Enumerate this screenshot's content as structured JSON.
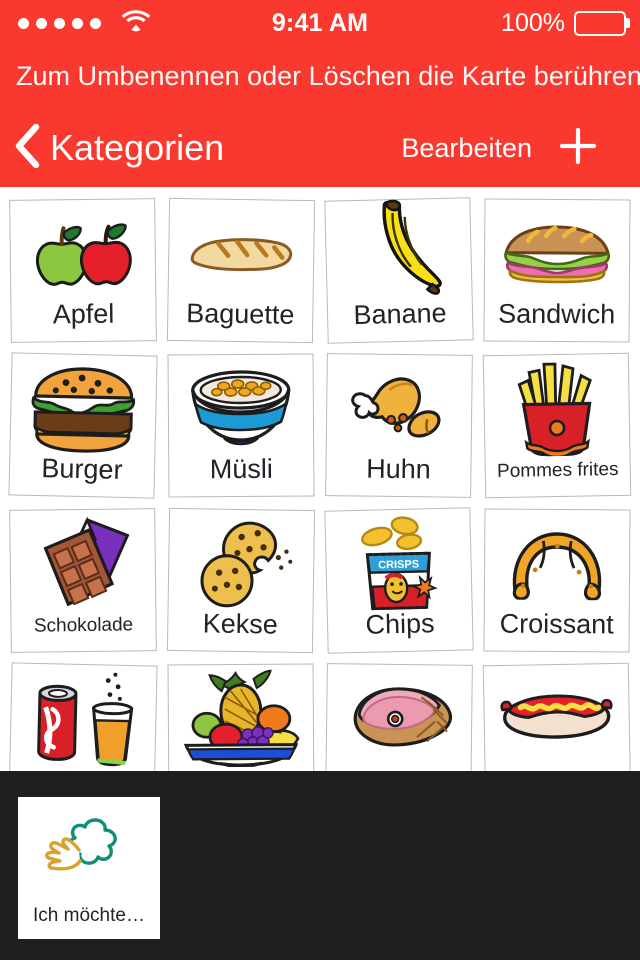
{
  "status_bar": {
    "signal_dots": 5,
    "wifi_icon": "wifi-icon",
    "time": "9:41 AM",
    "battery_percent": "100%",
    "battery_icon": "battery-full-icon"
  },
  "banner": {
    "text": "Zum Umbenennen oder Löschen die Karte berühren"
  },
  "navbar": {
    "back_icon": "chevron-left-icon",
    "back_label": "Kategorien",
    "edit_label": "Bearbeiten",
    "add_icon": "plus-icon"
  },
  "colors": {
    "header_red": "#f9392f",
    "bottom_bar": "#1f1f1f",
    "card_border": "#b9b9bd",
    "label_text": "#222228"
  },
  "grid": {
    "cards": [
      {
        "label": "Apfel",
        "icon": "apple-icon",
        "small": false
      },
      {
        "label": "Baguette",
        "icon": "baguette-icon",
        "small": false
      },
      {
        "label": "Banane",
        "icon": "banana-icon",
        "small": false
      },
      {
        "label": "Sandwich",
        "icon": "sandwich-icon",
        "small": false
      },
      {
        "label": "Burger",
        "icon": "burger-icon",
        "small": false
      },
      {
        "label": "Müsli",
        "icon": "cereal-bowl-icon",
        "small": false
      },
      {
        "label": "Huhn",
        "icon": "chicken-leg-icon",
        "small": false
      },
      {
        "label": "Pommes frites",
        "icon": "fries-icon",
        "small": true
      },
      {
        "label": "Schokolade",
        "icon": "chocolate-icon",
        "small": true
      },
      {
        "label": "Kekse",
        "icon": "cookies-icon",
        "small": false
      },
      {
        "label": "Chips",
        "icon": "chips-bag-icon",
        "small": false
      },
      {
        "label": "Croissant",
        "icon": "croissant-icon",
        "small": false
      },
      {
        "label": "",
        "icon": "drinks-icon",
        "small": false
      },
      {
        "label": "",
        "icon": "fruit-bowl-icon",
        "small": false
      },
      {
        "label": "",
        "icon": "ham-icon",
        "small": false
      },
      {
        "label": "",
        "icon": "hotdog-icon",
        "small": false
      }
    ]
  },
  "sentence_bar": {
    "card": {
      "label": "Ich möchte…",
      "icon": "hand-speech-icon"
    }
  }
}
